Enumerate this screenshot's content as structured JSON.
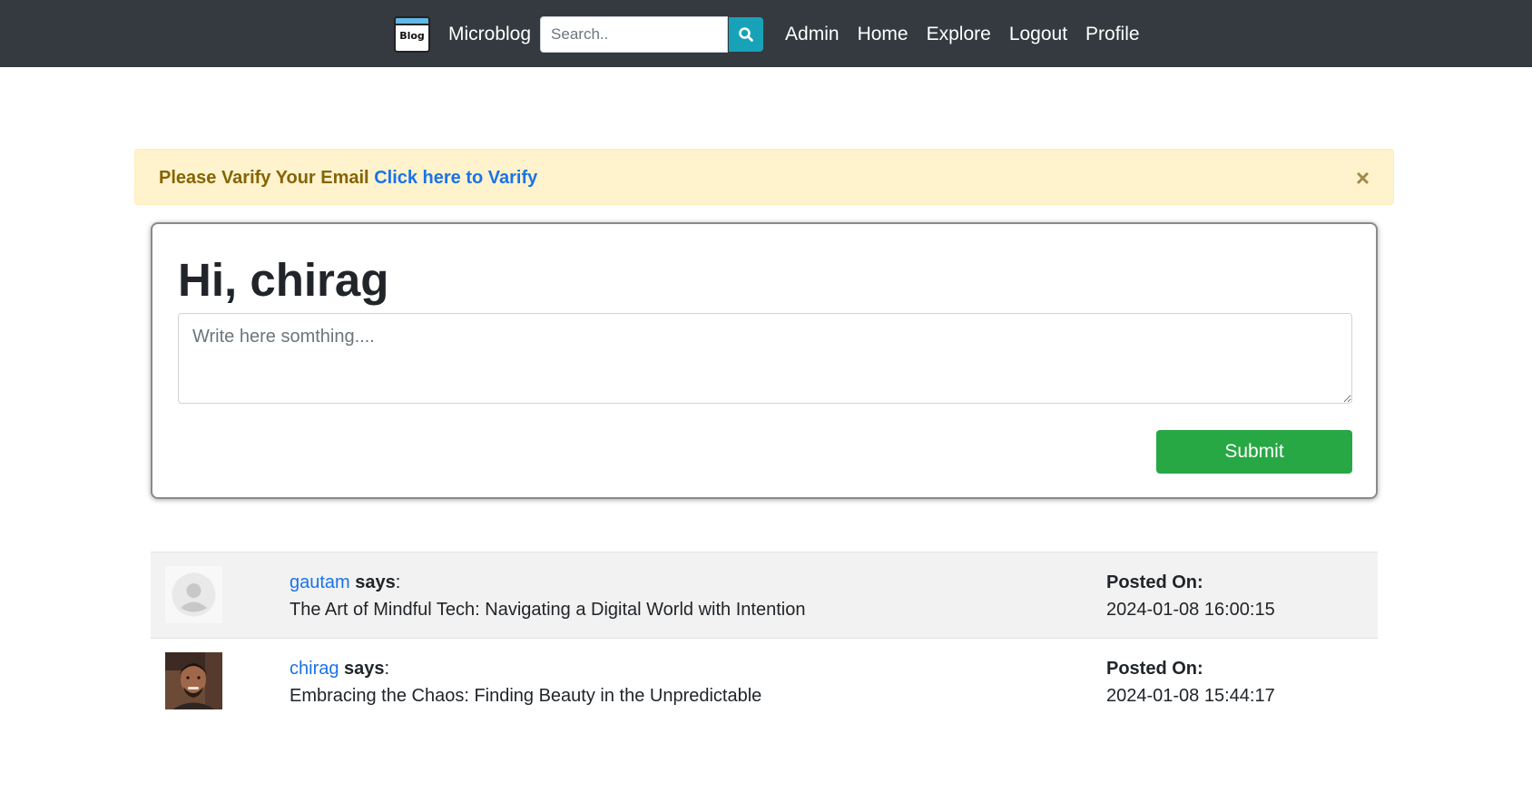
{
  "navbar": {
    "logo_text": "Blog",
    "brand": "Microblog",
    "search_placeholder": "Search..",
    "links": [
      "Admin",
      "Home",
      "Explore",
      "Logout",
      "Profile"
    ]
  },
  "alert": {
    "message": "Please Varify Your Email",
    "link_text": "Click here to Varify",
    "close_symbol": "×"
  },
  "compose": {
    "greeting": "Hi, chirag",
    "placeholder": "Write here somthing....",
    "submit_label": "Submit"
  },
  "posts": [
    {
      "author": "gautam",
      "says": "says",
      "colon": ":",
      "body": "The Art of Mindful Tech: Navigating a Digital World with Intention",
      "posted_label": "Posted On:",
      "timestamp": "2024-01-08 16:00:15"
    },
    {
      "author": "chirag",
      "says": "says",
      "colon": ":",
      "body": "Embracing the Chaos: Finding Beauty in the Unpredictable",
      "posted_label": "Posted On:",
      "timestamp": "2024-01-08 15:44:17"
    }
  ],
  "colors": {
    "navbar_bg": "#343a40",
    "search_button": "#17a2b8",
    "alert_bg": "#fff3cd",
    "alert_text": "#856404",
    "link": "#1a73e8",
    "submit": "#28a745"
  }
}
